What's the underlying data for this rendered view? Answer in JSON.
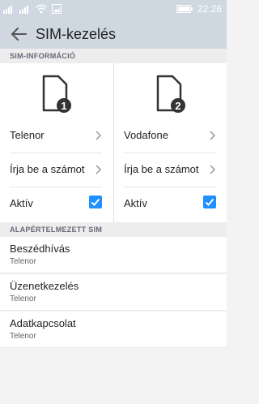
{
  "status": {
    "time": "22:26"
  },
  "header": {
    "title": "SIM-kezelés"
  },
  "sim_info": {
    "header": "SIM-INFORMÁCIÓ",
    "sims": [
      {
        "slot": "1",
        "operator": "Telenor",
        "number_label": "Írja be a számot",
        "active_label": "Aktív",
        "active": true
      },
      {
        "slot": "2",
        "operator": "Vodafone",
        "number_label": "Írja be a számot",
        "active_label": "Aktív",
        "active": true
      }
    ]
  },
  "default_sim": {
    "header": "ALAPÉRTELMEZETT SIM",
    "items": [
      {
        "title": "Beszédhívás",
        "value": "Telenor"
      },
      {
        "title": "Üzenetkezelés",
        "value": "Telenor"
      },
      {
        "title": "Adatkapcsolat",
        "value": "Telenor"
      }
    ]
  },
  "colors": {
    "accent": "#1e90ff",
    "toolbar": "#cfd8e0"
  }
}
